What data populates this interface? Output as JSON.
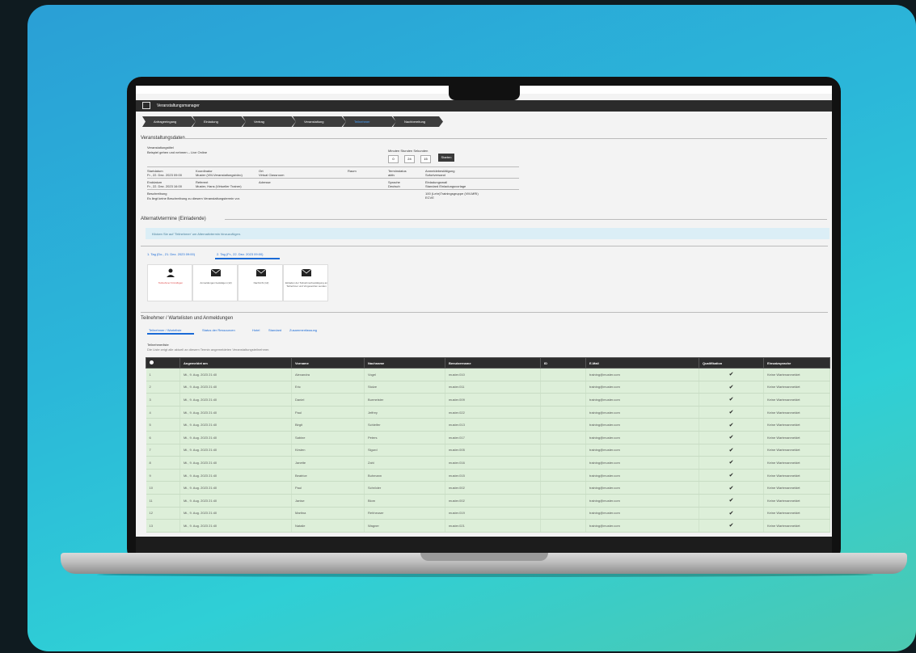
{
  "app": {
    "title": "Veranstaltungsmanager"
  },
  "steps": [
    {
      "label": "Anfrageeingang",
      "active": false
    },
    {
      "label": "Einladung",
      "active": false
    },
    {
      "label": "Vertrag",
      "active": false
    },
    {
      "label": "Veranstaltung",
      "active": false
    },
    {
      "label": "Teilnehmer",
      "active": true
    },
    {
      "label": "Nachbereitung",
      "active": false
    }
  ],
  "event": {
    "section_title": "Veranstaltungsdaten",
    "name_label": "Veranstaltungstitel",
    "name_value": "Beispiel gehen und nehmen – Live Online",
    "timer_label": "Minuten  Stunden  Sekunden",
    "timer_values": [
      "0",
      "24",
      "15"
    ],
    "timer_button": "Starten",
    "row1": [
      "Startdatum",
      "Koordinator",
      "Ort",
      "Raum",
      "Terminstatus",
      "Anmeldebestätigung"
    ],
    "row1_vals": [
      "Fr., 22. Dez. 2023 09:00",
      "Muster (VM-Veranstaltungsbüro)",
      "Virtual Classroom",
      "",
      "aktiv",
      "Sofortversand"
    ],
    "row2": [
      "Enddatum",
      "Referent",
      "Adresse",
      "",
      "Sprache",
      "Einladungsmail"
    ],
    "row2_vals": [
      "Fr., 22. Dez. 2023 16:00",
      "Muster, Hans (Virtueller Trainer)",
      "",
      "",
      "Deutsch",
      "Standard Einladungsvorlage"
    ],
    "desc_label": "Beschreibung",
    "desc_value": "Es liegt keine Beschreibung zu diesem Veranstaltungstermin vor.",
    "extra": "100 (Lehr)Trainingsgruppe (VM-MRI) ECVE"
  },
  "alt_section": {
    "title": "Alternativtermine (Einladende)",
    "info": "Klicken Sie auf 'Teilnehmer' um Alternativtermin hinzuzufügen."
  },
  "day_tabs": [
    "1. Tag (Do., 21. Dez. 2023 09:00)",
    "2. Tag (Fr., 22. Dez. 2023 09:00)"
  ],
  "tiles": [
    {
      "icon": "user-add-icon",
      "label": "Teilnehmer hinzufügen",
      "red": true
    },
    {
      "icon": "mail-icon",
      "label": "Anmeldungen bestätigen (12)",
      "red": false
    },
    {
      "icon": "mail-icon",
      "label": "Nachricht (12)",
      "red": false
    },
    {
      "icon": "mail-icon",
      "label": "Einladen der Teilnehmerbestätigung an Teilnehmer und Vorgesetzten senden",
      "red": false
    }
  ],
  "participants": {
    "title": "Teilnehmer / Wartelisten und Anmeldungen",
    "tabs": [
      "Teilnehmer / Warteliste",
      "Status der Ressourcen",
      "Hotel",
      "Standard",
      "Zusammenfassung"
    ],
    "list_label": "Teilnehmerliste",
    "list_hint": "Die Liste zeigt alle aktuell an diesem Termin angemeldeten Veranstaltungsteilnehmer.",
    "columns": [
      "",
      "Angemeldet am",
      "Vorname",
      "Nachname",
      "Benutzername",
      "ID",
      "E-Mail",
      "Qualifikation",
      "Einsatzsprache"
    ],
    "rows": [
      [
        "1",
        "Mi., 9. Aug. 2023 21:40",
        "Alexandra",
        "Vogel",
        "muster.010",
        "",
        "training@muster.com",
        "✔",
        "Keine Wartenanmeldet"
      ],
      [
        "2",
        "Mi., 9. Aug. 2023 21:40",
        "Eric",
        "Stolze",
        "muster.011",
        "",
        "training@muster.com",
        "✔",
        "Keine Wartenanmeldet"
      ],
      [
        "3",
        "Mi., 9. Aug. 2023 21:40",
        "Daniel",
        "Burmeister",
        "muster.009",
        "",
        "training@muster.com",
        "✔",
        "Keine Wartenanmeldet"
      ],
      [
        "4",
        "Mi., 9. Aug. 2023 21:40",
        "Paul",
        "Jeffrey",
        "muster.022",
        "",
        "training@muster.com",
        "✔",
        "Keine Wartenanmeldet"
      ],
      [
        "5",
        "Mi., 9. Aug. 2023 21:40",
        "Birgit",
        "Schleifer",
        "muster.013",
        "",
        "training@muster.com",
        "✔",
        "Keine Wartenanmeldet"
      ],
      [
        "6",
        "Mi., 9. Aug. 2023 21:40",
        "Sabine",
        "Peters",
        "muster.017",
        "",
        "training@muster.com",
        "✔",
        "Keine Wartenanmeldet"
      ],
      [
        "7",
        "Mi., 9. Aug. 2023 21:40",
        "Kirsten",
        "Sigurd",
        "muster.005",
        "",
        "training@muster.com",
        "✔",
        "Keine Wartenanmeldet"
      ],
      [
        "8",
        "Mi., 9. Aug. 2023 21:40",
        "Janette",
        "Zahl",
        "muster.016",
        "",
        "training@muster.com",
        "✔",
        "Keine Wartenanmeldet"
      ],
      [
        "9",
        "Mi., 9. Aug. 2023 21:40",
        "Beatrice",
        "Buhmann",
        "muster.015",
        "",
        "training@muster.com",
        "✔",
        "Keine Wartenanmeldet"
      ],
      [
        "10",
        "Mi., 9. Aug. 2023 21:40",
        "Paul",
        "Schröder",
        "muster.002",
        "",
        "training@muster.com",
        "✔",
        "Keine Wartenanmeldet"
      ],
      [
        "11",
        "Mi., 9. Aug. 2023 21:40",
        "Janise",
        "Blom",
        "muster.002",
        "",
        "training@muster.com",
        "✔",
        "Keine Wartenanmeldet"
      ],
      [
        "12",
        "Mi., 9. Aug. 2023 21:40",
        "Martina",
        "Rehheuser",
        "muster.019",
        "",
        "training@muster.com",
        "✔",
        "Keine Wartenanmeldet"
      ],
      [
        "13",
        "Mi., 9. Aug. 2023 21:40",
        "Natalie",
        "Wagner",
        "muster.021",
        "",
        "training@muster.com",
        "✔",
        "Keine Wartenanmeldet"
      ]
    ]
  }
}
